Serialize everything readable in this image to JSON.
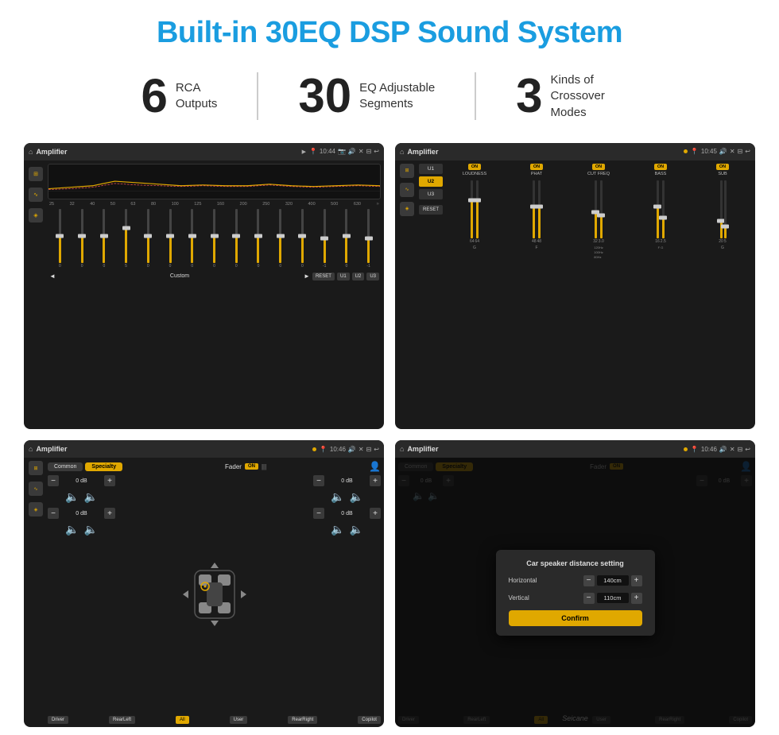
{
  "page": {
    "background": "#ffffff"
  },
  "header": {
    "title": "Built-in 30EQ DSP Sound System"
  },
  "stats": [
    {
      "number": "6",
      "label": "RCA\nOutputs"
    },
    {
      "number": "30",
      "label": "EQ Adjustable\nSegments"
    },
    {
      "number": "3",
      "label": "Kinds of\nCrossover Modes"
    }
  ],
  "screens": {
    "screen1": {
      "topbar": {
        "icon": "⌂",
        "title": "Amplifier",
        "time": "10:44"
      },
      "eq_freqs": [
        "25",
        "32",
        "40",
        "50",
        "63",
        "80",
        "100",
        "125",
        "160",
        "200",
        "250",
        "320",
        "400",
        "500",
        "630"
      ],
      "eq_values": [
        "0",
        "0",
        "0",
        "5",
        "0",
        "0",
        "0",
        "0",
        "0",
        "0",
        "0",
        "0",
        "-1",
        "0",
        "-1"
      ],
      "presets": [
        "Custom",
        "RESET",
        "U1",
        "U2",
        "U3"
      ]
    },
    "screen2": {
      "topbar": {
        "title": "Amplifier",
        "time": "10:45"
      },
      "channels": [
        "LOUDNESS",
        "PHAT",
        "CUT FREQ",
        "BASS",
        "SUB"
      ],
      "preset_buttons": [
        "U1",
        "U2",
        "U3"
      ],
      "reset_label": "RESET"
    },
    "screen3": {
      "topbar": {
        "title": "Amplifier",
        "time": "10:46"
      },
      "tabs": [
        "Common",
        "Specialty"
      ],
      "fader_title": "Fader",
      "fader_on": "ON",
      "vol_values": [
        "0 dB",
        "0 dB",
        "0 dB",
        "0 dB"
      ],
      "labels": [
        "Driver",
        "RearLeft",
        "All",
        "User",
        "RearRight",
        "Copilot"
      ]
    },
    "screen4": {
      "topbar": {
        "title": "Amplifier",
        "time": "10:46"
      },
      "dialog": {
        "title": "Car speaker distance setting",
        "horizontal_label": "Horizontal",
        "horizontal_value": "140cm",
        "vertical_label": "Vertical",
        "vertical_value": "110cm",
        "confirm_label": "Confirm"
      },
      "labels": [
        "Driver",
        "RearLeft",
        "All",
        "User",
        "RearRight",
        "Copilot"
      ],
      "vol_values": [
        "0 dB",
        "0 dB"
      ]
    }
  },
  "watermark": "Seicane"
}
